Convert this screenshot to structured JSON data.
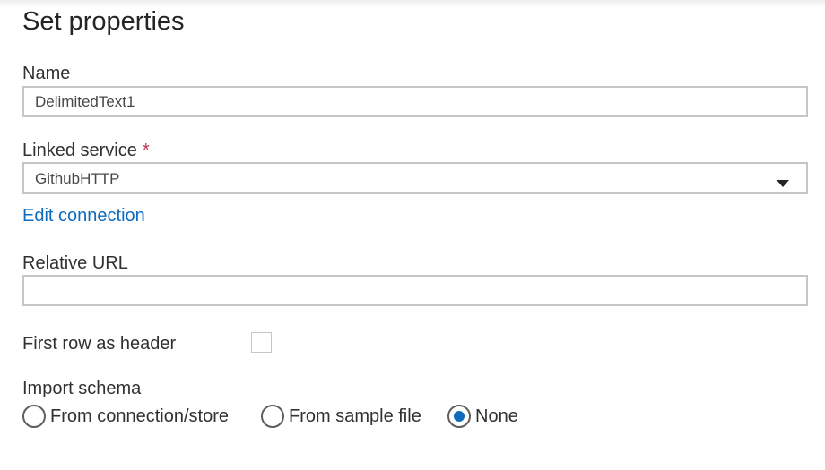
{
  "panel": {
    "title": "Set properties"
  },
  "name_field": {
    "label": "Name",
    "value": "DelimitedText1"
  },
  "linked_service": {
    "label": "Linked service",
    "required_marker": "*",
    "selected": "GithubHTTP",
    "edit_link": "Edit connection"
  },
  "relative_url": {
    "label": "Relative URL",
    "value": ""
  },
  "first_row_header": {
    "label": "First row as header",
    "checked": false
  },
  "import_schema": {
    "label": "Import schema",
    "options": [
      {
        "label": "From connection/store",
        "checked": false
      },
      {
        "label": "From sample file",
        "checked": false
      },
      {
        "label": "None",
        "checked": true
      }
    ]
  },
  "colors": {
    "accent": "#0f6cbd",
    "required": "#c4314b",
    "border": "#c8c6c4",
    "text": "#323130"
  },
  "icons": {
    "dropdown": "chevron-down-icon"
  }
}
